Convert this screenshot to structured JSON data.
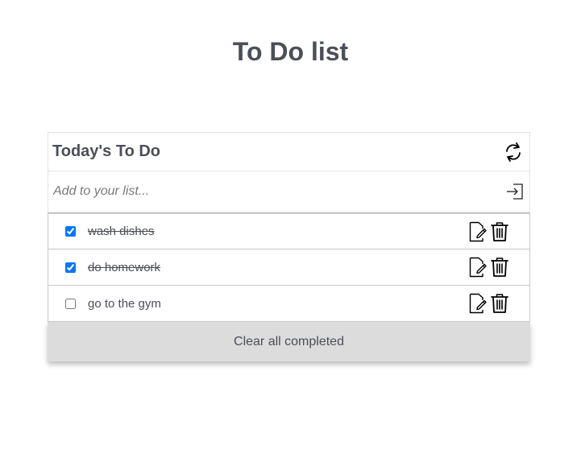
{
  "page": {
    "title": "To Do list"
  },
  "card": {
    "title": "Today's To Do",
    "refresh_icon": "refresh-icon"
  },
  "add": {
    "placeholder": "Add to your list...",
    "value": "",
    "submit_icon": "enter-icon"
  },
  "tasks": [
    {
      "label": "wash dishes",
      "completed": true
    },
    {
      "label": "do homework",
      "completed": true
    },
    {
      "label": "go to the gym",
      "completed": false
    }
  ],
  "actions": {
    "edit_icon": "edit-icon",
    "delete_icon": "trash-icon"
  },
  "footer": {
    "clear_label": "Clear all completed"
  },
  "colors": {
    "text": "#4b4f58",
    "border": "#e3e3e3",
    "row_border": "#c8c8c8",
    "clear_bg": "#dcdcdc",
    "checkbox_accent": "#0075ff"
  }
}
